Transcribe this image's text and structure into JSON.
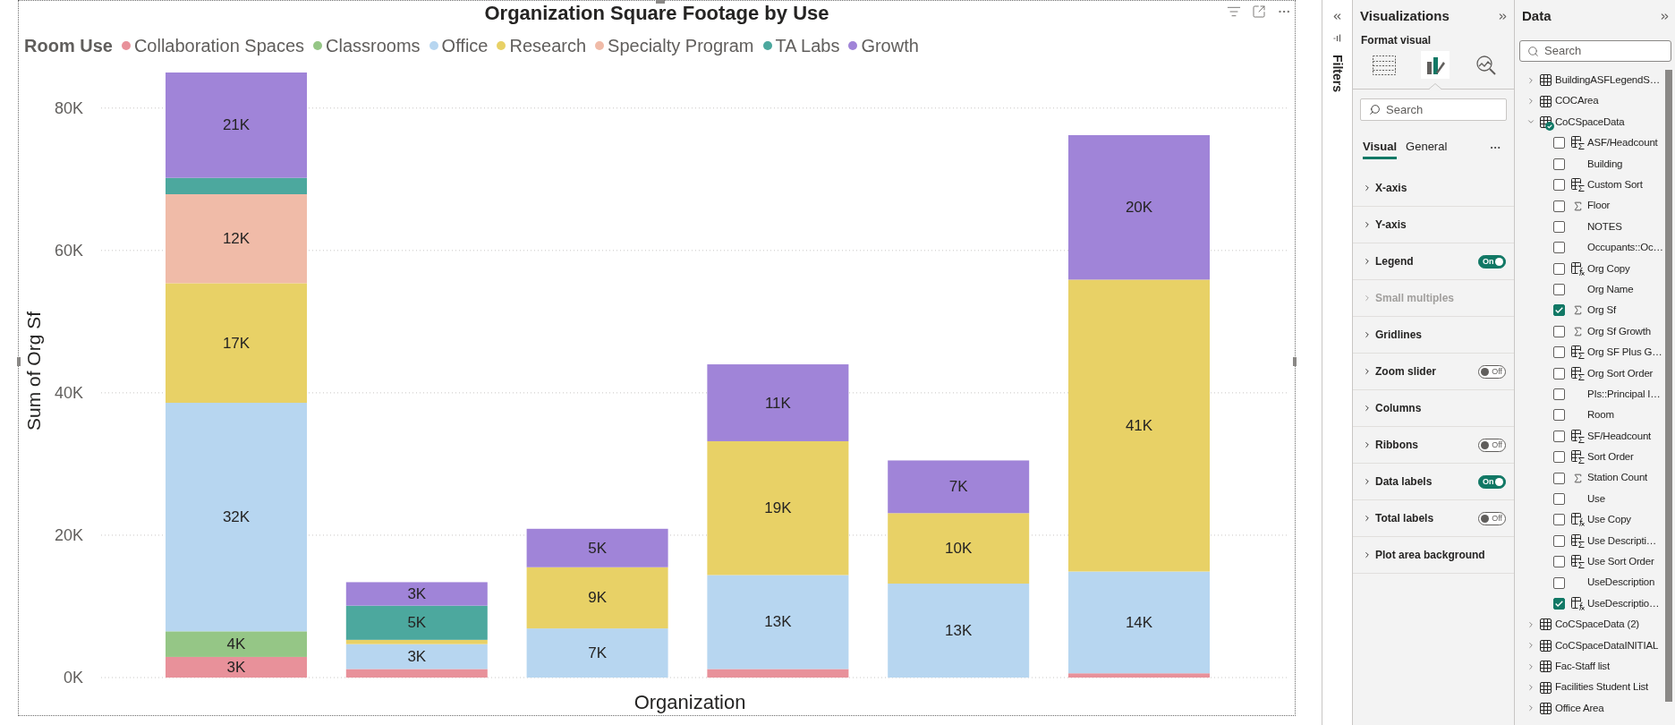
{
  "chart": {
    "chart_data": {
      "type": "bar",
      "title": "Organization Square Footage by Use",
      "legend": {
        "title": "Room Use"
      },
      "xlabel": "Organization",
      "ylabel": "Sum of Org Sf",
      "stacked": true,
      "orientation": "vertical",
      "grid": true,
      "ylim": [
        0,
        85000
      ],
      "yticks": [
        {
          "value": 0,
          "label": "0K"
        },
        {
          "value": 20000,
          "label": "20K"
        },
        {
          "value": 40000,
          "label": "40K"
        },
        {
          "value": 60000,
          "label": "60K"
        },
        {
          "value": 80000,
          "label": "80K"
        }
      ],
      "data_labels": true,
      "series": [
        {
          "name": "Collaboration Spaces",
          "color": "#e8919a",
          "values": [
            2900,
            1200,
            null,
            1200,
            null,
            600
          ],
          "value_labels": [
            "3K",
            null,
            null,
            null,
            null,
            null
          ]
        },
        {
          "name": "Classrooms",
          "color": "#95c686",
          "values": [
            3600,
            null,
            null,
            null,
            null,
            null
          ],
          "value_labels": [
            "4K",
            null,
            null,
            null,
            null,
            null
          ]
        },
        {
          "name": "Office",
          "color": "#b7d6f0",
          "values": [
            32100,
            3500,
            6900,
            13200,
            13200,
            14300
          ],
          "value_labels": [
            "32K",
            "3K",
            "7K",
            "13K",
            "13K",
            "14K"
          ]
        },
        {
          "name": "Research",
          "color": "#e8d166",
          "values": [
            16800,
            600,
            8600,
            18800,
            9900,
            41000
          ],
          "value_labels": [
            "17K",
            null,
            "9K",
            "19K",
            "10K",
            "41K"
          ]
        },
        {
          "name": "Specialty Program",
          "color": "#f0bba8",
          "values": [
            12500,
            null,
            null,
            null,
            null,
            null
          ],
          "value_labels": [
            "12K",
            null,
            null,
            null,
            null,
            null
          ]
        },
        {
          "name": "TA Labs",
          "color": "#4ca89e",
          "values": [
            2300,
            4800,
            null,
            null,
            null,
            null
          ],
          "value_labels": [
            null,
            "5K",
            null,
            null,
            null,
            null
          ]
        },
        {
          "name": "Growth",
          "color": "#a084d8",
          "values": [
            14900,
            3300,
            5400,
            10800,
            7400,
            20300
          ],
          "value_labels": [
            null,
            "3K",
            "5K",
            "11K",
            "7K",
            "20K"
          ]
        }
      ],
      "annotations": [
        "21K"
      ]
    }
  },
  "filters_pane": {
    "label": "Filters"
  },
  "visualizations": {
    "title": "Visualizations",
    "subtitle": "Format visual",
    "modes": [
      {
        "kind": "build",
        "selected": false
      },
      {
        "kind": "format",
        "selected": true
      },
      {
        "kind": "analytics",
        "selected": false
      }
    ],
    "search": {
      "placeholder": "Search"
    },
    "tabs": [
      {
        "label": "Visual",
        "selected": true
      },
      {
        "label": "General",
        "selected": false
      }
    ],
    "sections": [
      {
        "label": "X-axis",
        "disabled": false
      },
      {
        "label": "Y-axis",
        "disabled": false
      },
      {
        "label": "Legend",
        "disabled": false,
        "toggle": {
          "on": true,
          "label": "On"
        }
      },
      {
        "label": "Small multiples",
        "disabled": true
      },
      {
        "label": "Gridlines",
        "disabled": false
      },
      {
        "label": "Zoom slider",
        "disabled": false,
        "toggle": {
          "on": false,
          "label": "Off"
        }
      },
      {
        "label": "Columns",
        "disabled": false
      },
      {
        "label": "Ribbons",
        "disabled": false,
        "toggle": {
          "on": false,
          "label": "Off"
        }
      },
      {
        "label": "Data labels",
        "disabled": false,
        "toggle": {
          "on": true,
          "label": "On"
        }
      },
      {
        "label": "Total labels",
        "disabled": false,
        "toggle": {
          "on": false,
          "label": "Off"
        }
      },
      {
        "label": "Plot area background",
        "disabled": false
      }
    ]
  },
  "data_pane": {
    "title": "Data",
    "search": {
      "placeholder": "Search"
    },
    "tables": [
      {
        "name": "BuildingASFLegendS…",
        "expanded": false,
        "in_use": false
      },
      {
        "name": "COCArea",
        "expanded": false,
        "in_use": false
      },
      {
        "name": "CoCSpaceData",
        "expanded": true,
        "in_use": true,
        "children": [
          {
            "name": "ASF/Headcount",
            "kind": "calc",
            "checked": false
          },
          {
            "name": "Building",
            "kind": "plain",
            "checked": false
          },
          {
            "name": "Custom Sort",
            "kind": "calc",
            "checked": false
          },
          {
            "name": "Floor",
            "kind": "sigma",
            "checked": false
          },
          {
            "name": "NOTES",
            "kind": "plain",
            "checked": false
          },
          {
            "name": "Occupants::Oc…",
            "kind": "plain",
            "checked": false
          },
          {
            "name": "Org Copy",
            "kind": "measure",
            "checked": false
          },
          {
            "name": "Org Name",
            "kind": "plain",
            "checked": false
          },
          {
            "name": "Org Sf",
            "kind": "sigma",
            "checked": true
          },
          {
            "name": "Org Sf Growth",
            "kind": "sigma",
            "checked": false
          },
          {
            "name": "Org SF Plus G…",
            "kind": "calc",
            "checked": false
          },
          {
            "name": "Org Sort Order",
            "kind": "calc",
            "checked": false
          },
          {
            "name": "PIs::Principal I…",
            "kind": "plain",
            "checked": false
          },
          {
            "name": "Room",
            "kind": "plain",
            "checked": false
          },
          {
            "name": "SF/Headcount",
            "kind": "calc",
            "checked": false
          },
          {
            "name": "Sort Order",
            "kind": "calc",
            "checked": false
          },
          {
            "name": "Station Count",
            "kind": "sigma",
            "checked": false
          },
          {
            "name": "Use",
            "kind": "plain",
            "checked": false
          },
          {
            "name": "Use Copy",
            "kind": "measure",
            "checked": false
          },
          {
            "name": "Use Descripti…",
            "kind": "calc",
            "checked": false
          },
          {
            "name": "Use Sort Order",
            "kind": "calc",
            "checked": false
          },
          {
            "name": "UseDescription",
            "kind": "plain",
            "checked": false
          },
          {
            "name": "UseDescriptio…",
            "kind": "measure",
            "checked": true
          }
        ]
      },
      {
        "name": "CoCSpaceData (2)",
        "expanded": false,
        "in_use": false
      },
      {
        "name": "CoCSpaceDataINITIAL",
        "expanded": false,
        "in_use": false
      },
      {
        "name": "Fac-Staff list",
        "expanded": false,
        "in_use": false
      },
      {
        "name": "Facilities Student List",
        "expanded": false,
        "in_use": false
      },
      {
        "name": "Office Area",
        "expanded": false,
        "in_use": false
      }
    ]
  }
}
